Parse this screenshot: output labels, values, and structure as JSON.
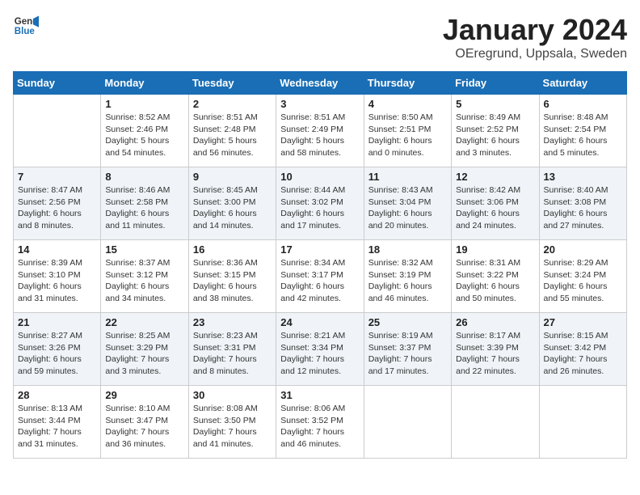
{
  "header": {
    "logo_line1": "General",
    "logo_line2": "Blue",
    "month": "January 2024",
    "location": "OEregrund, Uppsala, Sweden"
  },
  "days_of_week": [
    "Sunday",
    "Monday",
    "Tuesday",
    "Wednesday",
    "Thursday",
    "Friday",
    "Saturday"
  ],
  "weeks": [
    [
      {
        "day": "",
        "content": ""
      },
      {
        "day": "1",
        "content": "Sunrise: 8:52 AM\nSunset: 2:46 PM\nDaylight: 5 hours\nand 54 minutes."
      },
      {
        "day": "2",
        "content": "Sunrise: 8:51 AM\nSunset: 2:48 PM\nDaylight: 5 hours\nand 56 minutes."
      },
      {
        "day": "3",
        "content": "Sunrise: 8:51 AM\nSunset: 2:49 PM\nDaylight: 5 hours\nand 58 minutes."
      },
      {
        "day": "4",
        "content": "Sunrise: 8:50 AM\nSunset: 2:51 PM\nDaylight: 6 hours\nand 0 minutes."
      },
      {
        "day": "5",
        "content": "Sunrise: 8:49 AM\nSunset: 2:52 PM\nDaylight: 6 hours\nand 3 minutes."
      },
      {
        "day": "6",
        "content": "Sunrise: 8:48 AM\nSunset: 2:54 PM\nDaylight: 6 hours\nand 5 minutes."
      }
    ],
    [
      {
        "day": "7",
        "content": "Sunrise: 8:47 AM\nSunset: 2:56 PM\nDaylight: 6 hours\nand 8 minutes."
      },
      {
        "day": "8",
        "content": "Sunrise: 8:46 AM\nSunset: 2:58 PM\nDaylight: 6 hours\nand 11 minutes."
      },
      {
        "day": "9",
        "content": "Sunrise: 8:45 AM\nSunset: 3:00 PM\nDaylight: 6 hours\nand 14 minutes."
      },
      {
        "day": "10",
        "content": "Sunrise: 8:44 AM\nSunset: 3:02 PM\nDaylight: 6 hours\nand 17 minutes."
      },
      {
        "day": "11",
        "content": "Sunrise: 8:43 AM\nSunset: 3:04 PM\nDaylight: 6 hours\nand 20 minutes."
      },
      {
        "day": "12",
        "content": "Sunrise: 8:42 AM\nSunset: 3:06 PM\nDaylight: 6 hours\nand 24 minutes."
      },
      {
        "day": "13",
        "content": "Sunrise: 8:40 AM\nSunset: 3:08 PM\nDaylight: 6 hours\nand 27 minutes."
      }
    ],
    [
      {
        "day": "14",
        "content": "Sunrise: 8:39 AM\nSunset: 3:10 PM\nDaylight: 6 hours\nand 31 minutes."
      },
      {
        "day": "15",
        "content": "Sunrise: 8:37 AM\nSunset: 3:12 PM\nDaylight: 6 hours\nand 34 minutes."
      },
      {
        "day": "16",
        "content": "Sunrise: 8:36 AM\nSunset: 3:15 PM\nDaylight: 6 hours\nand 38 minutes."
      },
      {
        "day": "17",
        "content": "Sunrise: 8:34 AM\nSunset: 3:17 PM\nDaylight: 6 hours\nand 42 minutes."
      },
      {
        "day": "18",
        "content": "Sunrise: 8:32 AM\nSunset: 3:19 PM\nDaylight: 6 hours\nand 46 minutes."
      },
      {
        "day": "19",
        "content": "Sunrise: 8:31 AM\nSunset: 3:22 PM\nDaylight: 6 hours\nand 50 minutes."
      },
      {
        "day": "20",
        "content": "Sunrise: 8:29 AM\nSunset: 3:24 PM\nDaylight: 6 hours\nand 55 minutes."
      }
    ],
    [
      {
        "day": "21",
        "content": "Sunrise: 8:27 AM\nSunset: 3:26 PM\nDaylight: 6 hours\nand 59 minutes."
      },
      {
        "day": "22",
        "content": "Sunrise: 8:25 AM\nSunset: 3:29 PM\nDaylight: 7 hours\nand 3 minutes."
      },
      {
        "day": "23",
        "content": "Sunrise: 8:23 AM\nSunset: 3:31 PM\nDaylight: 7 hours\nand 8 minutes."
      },
      {
        "day": "24",
        "content": "Sunrise: 8:21 AM\nSunset: 3:34 PM\nDaylight: 7 hours\nand 12 minutes."
      },
      {
        "day": "25",
        "content": "Sunrise: 8:19 AM\nSunset: 3:37 PM\nDaylight: 7 hours\nand 17 minutes."
      },
      {
        "day": "26",
        "content": "Sunrise: 8:17 AM\nSunset: 3:39 PM\nDaylight: 7 hours\nand 22 minutes."
      },
      {
        "day": "27",
        "content": "Sunrise: 8:15 AM\nSunset: 3:42 PM\nDaylight: 7 hours\nand 26 minutes."
      }
    ],
    [
      {
        "day": "28",
        "content": "Sunrise: 8:13 AM\nSunset: 3:44 PM\nDaylight: 7 hours\nand 31 minutes."
      },
      {
        "day": "29",
        "content": "Sunrise: 8:10 AM\nSunset: 3:47 PM\nDaylight: 7 hours\nand 36 minutes."
      },
      {
        "day": "30",
        "content": "Sunrise: 8:08 AM\nSunset: 3:50 PM\nDaylight: 7 hours\nand 41 minutes."
      },
      {
        "day": "31",
        "content": "Sunrise: 8:06 AM\nSunset: 3:52 PM\nDaylight: 7 hours\nand 46 minutes."
      },
      {
        "day": "",
        "content": ""
      },
      {
        "day": "",
        "content": ""
      },
      {
        "day": "",
        "content": ""
      }
    ]
  ]
}
